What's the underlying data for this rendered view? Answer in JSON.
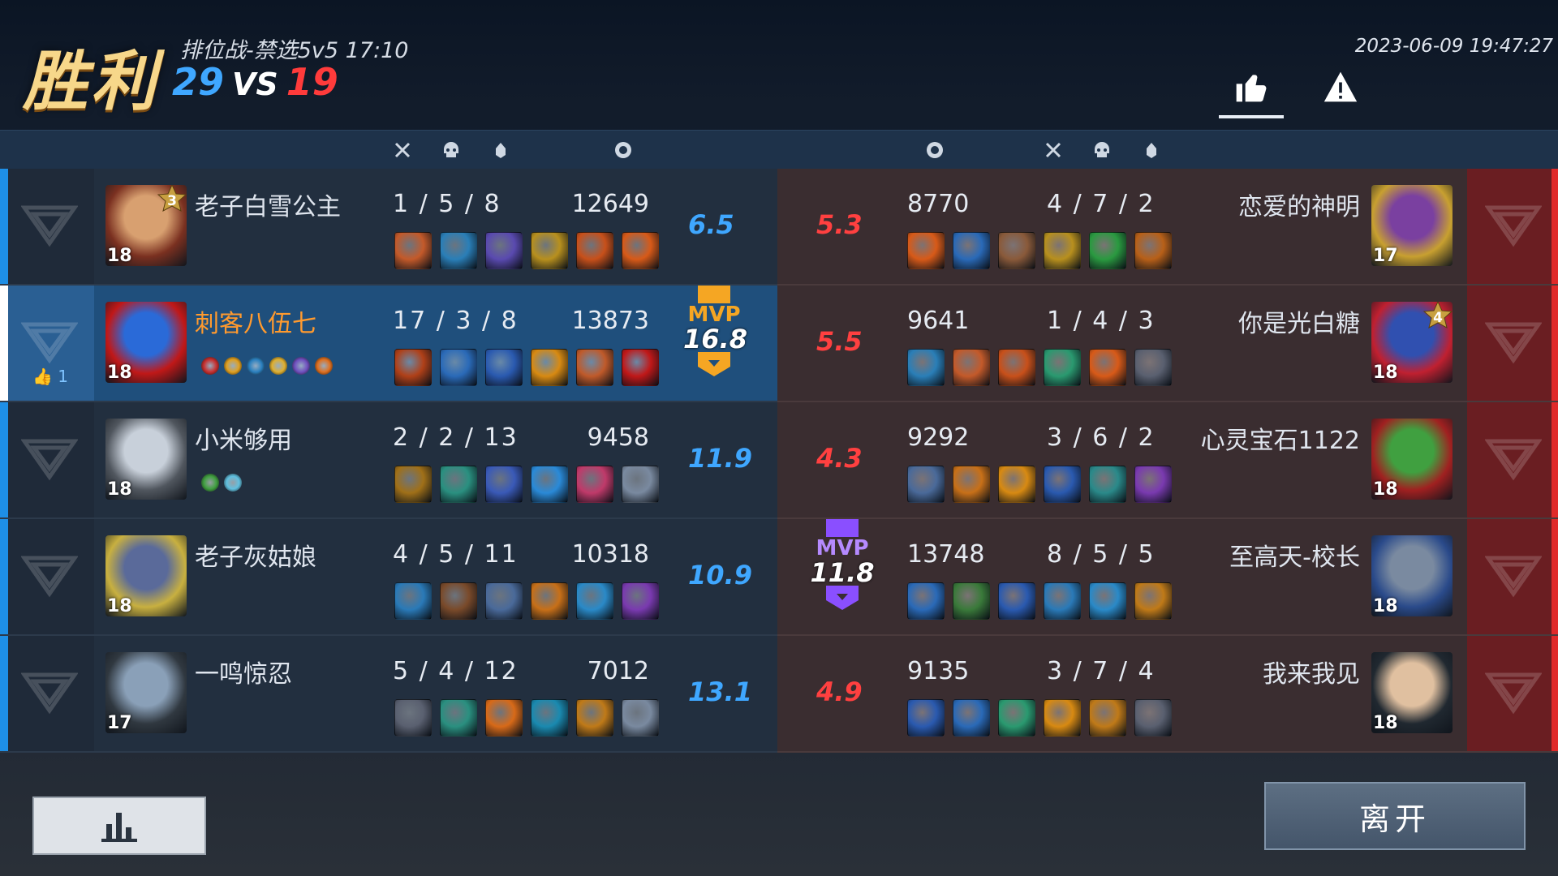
{
  "header": {
    "result": "胜利",
    "mode_time": "排位战-禁选5v5 17:10",
    "score_left": "29",
    "vs": "VS",
    "score_right": "19",
    "datetime": "2023-06-09 19:47:27",
    "like_icon": "thumbs-up-icon",
    "report_icon": "warning-icon"
  },
  "colors": {
    "blue": "#3fa7ff",
    "red": "#ff4040",
    "mvp_gold": "#f5a623",
    "mvp_purple": "#8a4fff",
    "me_name": "#ff9a2e"
  },
  "left_team": [
    {
      "name": "老子白雪公主",
      "level": "18",
      "rank": "3",
      "kda": "1 / 5 / 8",
      "gold": "12649",
      "rating": "6.5",
      "items": [
        "#c45a2a",
        "#2a7fb8",
        "#5a4ab0",
        "#b8901e",
        "#c8501a",
        "#d85a18"
      ]
    },
    {
      "name": "刺客八伍七",
      "level": "18",
      "kda": "17 / 3 / 8",
      "gold": "13873",
      "rating": "16.8",
      "likes": "1",
      "items": [
        "#b04018",
        "#2a6ab8",
        "#2a5ab0",
        "#d88a12",
        "#c05a2a",
        "#c01818"
      ],
      "buffs": [
        "#c83030",
        "#e0a020",
        "#2a80c0",
        "#e0b030",
        "#7050c0",
        "#e07020"
      ]
    },
    {
      "name": "小米够用",
      "level": "18",
      "kda": "2 / 2 / 13",
      "gold": "9458",
      "rating": "11.9",
      "items": [
        "#a07018",
        "#2a9080",
        "#3a5ab8",
        "#2a8ad8",
        "#c03a6a",
        "#7a8aa0"
      ],
      "buffs": [
        "#40a040",
        "#60c0e0"
      ]
    },
    {
      "name": "老子灰姑娘",
      "level": "18",
      "kda": "4 / 5 / 11",
      "gold": "10318",
      "rating": "10.9",
      "items": [
        "#2a7ab8",
        "#7a4a2a",
        "#4a6a9a",
        "#c87018",
        "#2a8ac8",
        "#7a3ab0"
      ]
    },
    {
      "name": "一鸣惊忍",
      "level": "17",
      "kda": "5 / 4 / 12",
      "gold": "7012",
      "rating": "13.1",
      "items": [
        "#5a6070",
        "#2a9080",
        "#d86a18",
        "#1a8ab0",
        "#c07a18",
        "#7a8aa0"
      ]
    }
  ],
  "right_team": [
    {
      "name": "恋爱的神明",
      "level": "17",
      "kda": "4 / 7 / 2",
      "gold": "8770",
      "rating": "5.3",
      "items": [
        "#d85a18",
        "#2a6ab8",
        "#8a5a3a",
        "#b8901e",
        "#2a9a40",
        "#b86018"
      ]
    },
    {
      "name": "你是光白糖",
      "level": "18",
      "rank": "4",
      "kda": "1 / 4 / 3",
      "gold": "9641",
      "rating": "5.5",
      "items": [
        "#2a7fb8",
        "#c45a2a",
        "#c8501a",
        "#2a9a70",
        "#d85a18",
        "#5a6070"
      ]
    },
    {
      "name": "心灵宝石1122",
      "level": "18",
      "kda": "3 / 6 / 2",
      "gold": "9292",
      "rating": "4.3",
      "items": [
        "#4a6a9a",
        "#c87018",
        "#d88a12",
        "#2a5ab0",
        "#2a8a8a",
        "#7a3ab0"
      ]
    },
    {
      "name": "至高天-校长",
      "level": "18",
      "kda": "8 / 5 / 5",
      "gold": "13748",
      "rating": "11.8",
      "items": [
        "#2a6ab8",
        "#3a7a3a",
        "#2a5ab0",
        "#2a7ab8",
        "#2a8ac8",
        "#c07a18"
      ]
    },
    {
      "name": "我来我见",
      "level": "18",
      "kda": "3 / 7 / 4",
      "gold": "9135",
      "rating": "4.9",
      "items": [
        "#2a5ab0",
        "#2a6ab8",
        "#2a9a70",
        "#d88a12",
        "#c07a18",
        "#5a6070"
      ]
    }
  ],
  "mvp_left": {
    "label": "MVP",
    "value": "16.8"
  },
  "mvp_right": {
    "label": "MVP",
    "value": "11.8"
  },
  "footer": {
    "stats_icon": "bar-chart-icon",
    "leave_label": "离开"
  }
}
